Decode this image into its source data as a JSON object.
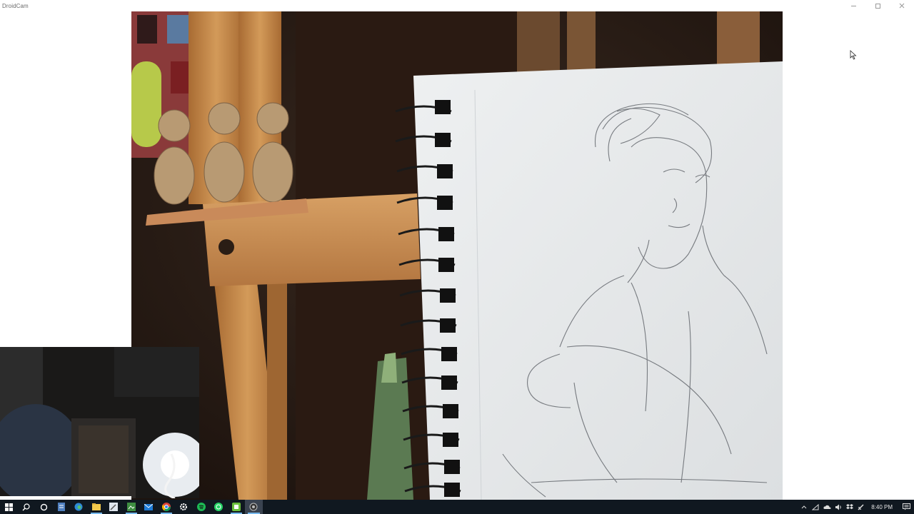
{
  "window": {
    "title": "DroidCam",
    "controls": [
      "minimize-icon",
      "maximize-icon",
      "close-icon"
    ]
  },
  "feed": {
    "scene": "easel-sketchbook-pencil-portrait"
  },
  "taskbar": {
    "apps": [
      {
        "icon": "windows-start-icon"
      },
      {
        "icon": "search-icon"
      },
      {
        "icon": "cortana-icon"
      },
      {
        "icon": "notepad-icon"
      },
      {
        "icon": "edge-icon"
      },
      {
        "icon": "file-explorer-icon"
      },
      {
        "icon": "pen-app-icon"
      },
      {
        "icon": "image-editor-icon"
      },
      {
        "icon": "mail-icon"
      },
      {
        "icon": "chrome-icon"
      },
      {
        "icon": "settings-icon"
      },
      {
        "icon": "spotify-icon"
      },
      {
        "icon": "whatsapp-icon"
      },
      {
        "icon": "green-app-icon"
      },
      {
        "icon": "droidcam-icon"
      }
    ],
    "tray": [
      "chevron-up-icon",
      "network-icon",
      "onedrive-icon",
      "volume-icon",
      "dropbox-icon",
      "pen-tray-icon"
    ],
    "time": "8:40 PM",
    "notification_icon": "notification-icon"
  },
  "colors": {
    "taskbar": "#101820",
    "accent": "#76b9ed",
    "wood": "#c98c4c",
    "paper": "#e9ebec"
  }
}
